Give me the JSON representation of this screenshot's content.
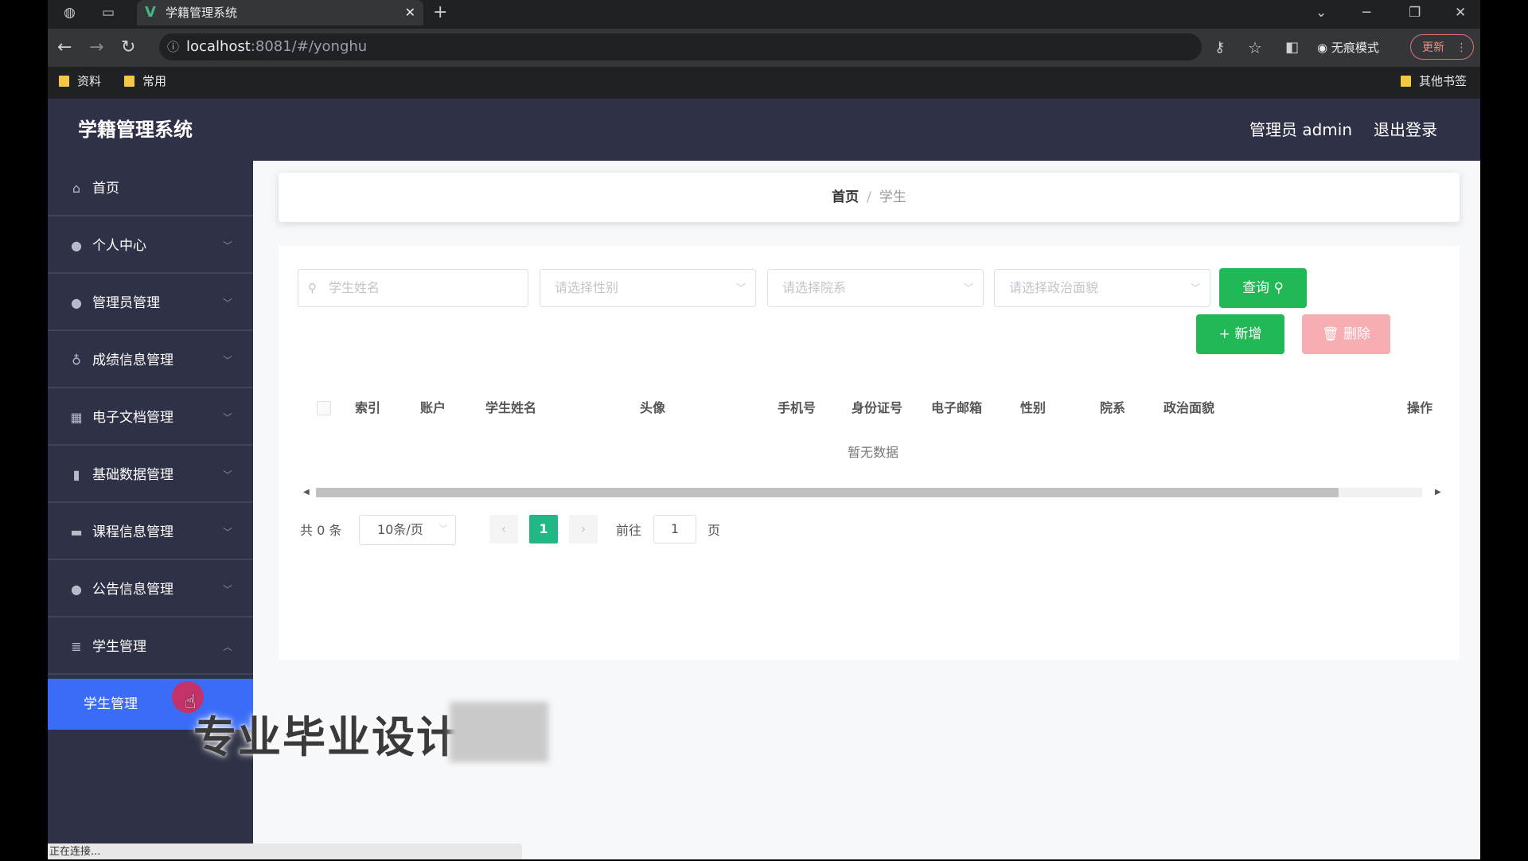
{
  "browser": {
    "tab_title": "学籍管理系统",
    "tab_favicon": "V",
    "url_host": "localhost",
    "url_rest": ":8081/#/yonghu",
    "incognito_label": "无痕模式",
    "update_label": "更新",
    "bookmarks": [
      "资料",
      "常用"
    ],
    "other_bookmarks": "其他书签",
    "status_text": "正在连接..."
  },
  "app": {
    "brand": "学籍管理系统",
    "user_label": "管理员 admin",
    "logout_label": "退出登录"
  },
  "sidebar": {
    "items": [
      {
        "label": "首页",
        "icon": "home-icon"
      },
      {
        "label": "个人中心",
        "icon": "user-icon"
      },
      {
        "label": "管理员管理",
        "icon": "pin-icon"
      },
      {
        "label": "成绩信息管理",
        "icon": "mic-icon"
      },
      {
        "label": "电子文档管理",
        "icon": "calendar-icon"
      },
      {
        "label": "基础数据管理",
        "icon": "bar-chart-icon"
      },
      {
        "label": "课程信息管理",
        "icon": "chat-icon"
      },
      {
        "label": "公告信息管理",
        "icon": "user-icon"
      },
      {
        "label": "学生管理",
        "icon": "stack-icon"
      }
    ],
    "active_sub": "学生管理"
  },
  "breadcrumb": {
    "home": "首页",
    "separator": "/",
    "current": "学生"
  },
  "filters": {
    "name_placeholder": "学生姓名",
    "gender_placeholder": "请选择性别",
    "dept_placeholder": "请选择院系",
    "politics_placeholder": "请选择政治面貌",
    "query_label": "查询"
  },
  "actions": {
    "add_label": "新增",
    "delete_label": "删除"
  },
  "table": {
    "columns": [
      "索引",
      "账户",
      "学生姓名",
      "头像",
      "手机号",
      "身份证号",
      "电子邮箱",
      "性别",
      "院系",
      "政治面貌",
      "操作"
    ],
    "empty_text": "暂无数据"
  },
  "pagination": {
    "total_text": "共 0 条",
    "page_size": "10条/页",
    "current_page": "1",
    "goto_label": "前往",
    "goto_value": "1",
    "page_unit": "页"
  },
  "overlay": {
    "watermark_text": "专业毕业设计"
  },
  "colors": {
    "sidebar_bg": "#2f3146",
    "active_menu": "#3b6cf8",
    "primary_green": "#21b856",
    "danger_light": "#f6aeb3"
  }
}
